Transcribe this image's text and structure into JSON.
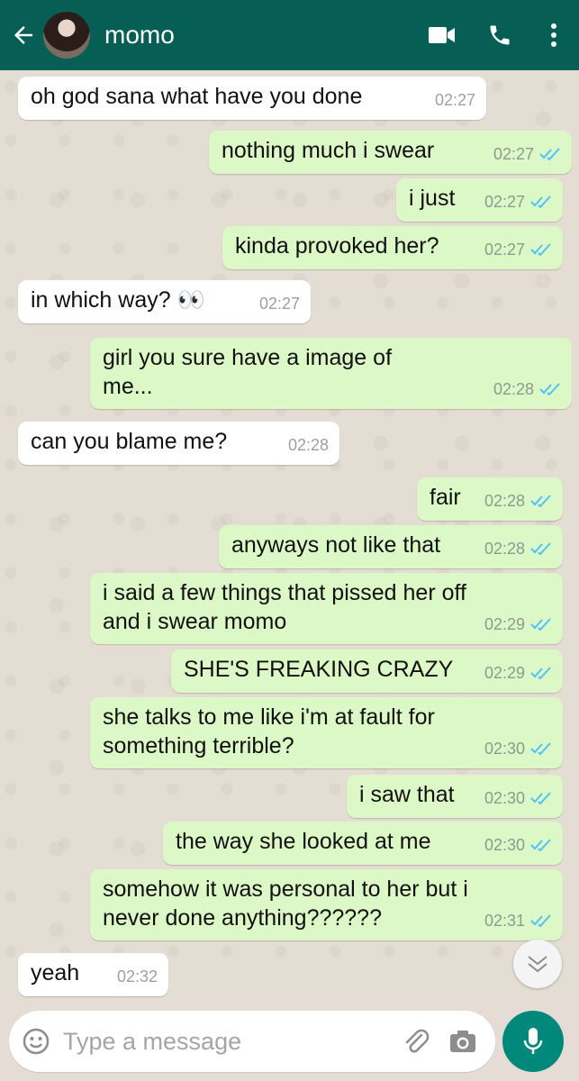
{
  "header": {
    "contact_name": "momo",
    "icons": [
      "back-arrow-icon",
      "video-call-icon",
      "phone-icon",
      "more-vert-icon"
    ],
    "bg_color": "#075e54"
  },
  "messages": [
    {
      "dir": "in",
      "text": "oh god sana what have you done",
      "time": "02:27"
    },
    {
      "dir": "out",
      "text": "nothing much i swear",
      "time": "02:27"
    },
    {
      "dir": "out",
      "text": "i just",
      "time": "02:27"
    },
    {
      "dir": "out",
      "text": "kinda provoked her?",
      "time": "02:27"
    },
    {
      "dir": "in",
      "text": "in which way? 👀",
      "time": "02:27"
    },
    {
      "dir": "out",
      "text": "girl you sure have a image of\nme...",
      "time": "02:28"
    },
    {
      "dir": "in",
      "text": "can you blame me?",
      "time": "02:28"
    },
    {
      "dir": "out",
      "text": "fair",
      "time": "02:28"
    },
    {
      "dir": "out",
      "text": "anyways not like that",
      "time": "02:28"
    },
    {
      "dir": "out",
      "text": "i said a few things that pissed her off\nand i swear momo",
      "time": "02:29"
    },
    {
      "dir": "out",
      "text": "SHE'S FREAKING CRAZY",
      "time": "02:29"
    },
    {
      "dir": "out",
      "text": "she talks to me like i'm at fault for\nsomething terrible?",
      "time": "02:30"
    },
    {
      "dir": "out",
      "text": "i saw that",
      "time": "02:30"
    },
    {
      "dir": "out",
      "text": "the way she looked at me",
      "time": "02:30"
    },
    {
      "dir": "out",
      "text": "somehow it was personal to her but i\nnever done anything??????",
      "time": "02:31"
    },
    {
      "dir": "in",
      "text": "yeah",
      "time": "02:32"
    }
  ],
  "composer": {
    "placeholder": "Type a message",
    "icons": [
      "emoji-icon",
      "attach-icon",
      "camera-icon",
      "mic-icon"
    ],
    "accent": "#00897b"
  },
  "colors": {
    "outgoing_bubble": "#dcf8c6",
    "incoming_bubble": "#ffffff",
    "read_ticks": "#4fc3f7"
  }
}
